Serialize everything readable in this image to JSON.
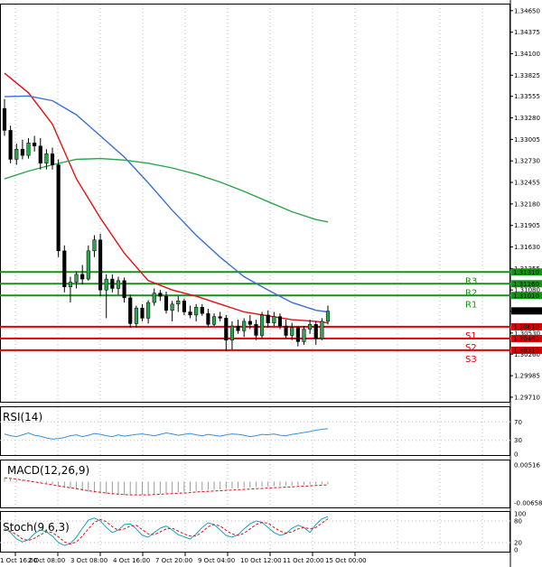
{
  "chart_data": {
    "type": "candlestick",
    "title": "",
    "x_labels": [
      "1 Oct 16:00",
      "2 Oct 08:00",
      "3 Oct 08:00",
      "4 Oct 16:00",
      "7 Oct 20:00",
      "9 Oct 04:00",
      "10 Oct 12:00",
      "11 Oct 20:00",
      "15 Oct 00:00"
    ],
    "y_ticks": [
      "1.34650",
      "1.34375",
      "1.34100",
      "1.33825",
      "1.33555",
      "1.33280",
      "1.33005",
      "1.32730",
      "1.32455",
      "1.32180",
      "1.31905",
      "1.31630",
      "1.31355",
      "1.31080",
      "1.30805",
      "1.30530",
      "1.30260",
      "1.29985",
      "1.29710"
    ],
    "ylim": [
      1.2964,
      1.3474
    ],
    "current_price": "1.30813",
    "levels": [
      {
        "name": "R3",
        "value": 1.3131,
        "label": "1.31310",
        "color": "#149414"
      },
      {
        "name": "R2",
        "value": 1.3116,
        "label": "1.31160",
        "color": "#149414"
      },
      {
        "name": "R1",
        "value": 1.3101,
        "label": "1.31010",
        "color": "#149414"
      },
      {
        "name": "S1",
        "value": 1.3061,
        "label": "1.30610",
        "color": "#e00000"
      },
      {
        "name": "S2",
        "value": 1.3046,
        "label": "1.30460",
        "color": "#e00000"
      },
      {
        "name": "S3",
        "value": 1.3031,
        "label": "1.30310",
        "color": "#e00000"
      }
    ],
    "candles": [
      [
        1.334,
        1.3352,
        1.3305,
        1.3312
      ],
      [
        1.3312,
        1.3318,
        1.327,
        1.3275
      ],
      [
        1.3275,
        1.3295,
        1.3268,
        1.3288
      ],
      [
        1.3288,
        1.33,
        1.3275,
        1.328
      ],
      [
        1.328,
        1.3302,
        1.3276,
        1.3296
      ],
      [
        1.3296,
        1.3305,
        1.3285,
        1.3292
      ],
      [
        1.3292,
        1.3302,
        1.3262,
        1.327
      ],
      [
        1.327,
        1.3288,
        1.3262,
        1.3282
      ],
      [
        1.3282,
        1.329,
        1.3262,
        1.3268
      ],
      [
        1.3268,
        1.3275,
        1.315,
        1.3158
      ],
      [
        1.3158,
        1.3165,
        1.3105,
        1.3112
      ],
      [
        1.3112,
        1.3125,
        1.3092,
        1.3118
      ],
      [
        1.3118,
        1.3132,
        1.311,
        1.3128
      ],
      [
        1.3128,
        1.314,
        1.3115,
        1.3122
      ],
      [
        1.3122,
        1.3165,
        1.312,
        1.3158
      ],
      [
        1.3158,
        1.3178,
        1.315,
        1.3172
      ],
      [
        1.3172,
        1.318,
        1.31,
        1.3108
      ],
      [
        1.3108,
        1.3128,
        1.3072,
        1.3122
      ],
      [
        1.3122,
        1.3128,
        1.3105,
        1.311
      ],
      [
        1.311,
        1.3125,
        1.3102,
        1.312
      ],
      [
        1.312,
        1.3124,
        1.3092,
        1.3098
      ],
      [
        1.3098,
        1.3102,
        1.306,
        1.3065
      ],
      [
        1.3065,
        1.3088,
        1.306,
        1.3085
      ],
      [
        1.3085,
        1.309,
        1.3068,
        1.3072
      ],
      [
        1.3072,
        1.3095,
        1.3065,
        1.3092
      ],
      [
        1.3092,
        1.311,
        1.3088,
        1.3104
      ],
      [
        1.3104,
        1.3108,
        1.3094,
        1.31
      ],
      [
        1.31,
        1.3106,
        1.3078,
        1.3082
      ],
      [
        1.3082,
        1.3094,
        1.3068,
        1.309
      ],
      [
        1.309,
        1.31,
        1.308,
        1.3094
      ],
      [
        1.3094,
        1.3097,
        1.3076,
        1.308
      ],
      [
        1.308,
        1.3088,
        1.3072,
        1.3076
      ],
      [
        1.3076,
        1.309,
        1.3068,
        1.3086
      ],
      [
        1.3086,
        1.309,
        1.3075,
        1.3078
      ],
      [
        1.3078,
        1.3084,
        1.306,
        1.3064
      ],
      [
        1.3064,
        1.3078,
        1.3062,
        1.3074
      ],
      [
        1.3074,
        1.308,
        1.3068,
        1.3072
      ],
      [
        1.3072,
        1.3076,
        1.303,
        1.3044
      ],
      [
        1.3044,
        1.3068,
        1.3032,
        1.3062
      ],
      [
        1.3062,
        1.307,
        1.3052,
        1.3056
      ],
      [
        1.3056,
        1.3072,
        1.3048,
        1.3068
      ],
      [
        1.3068,
        1.3076,
        1.3058,
        1.3064
      ],
      [
        1.3064,
        1.307,
        1.3044,
        1.305
      ],
      [
        1.305,
        1.308,
        1.3046,
        1.3076
      ],
      [
        1.3076,
        1.3082,
        1.306,
        1.3066
      ],
      [
        1.3066,
        1.308,
        1.3062,
        1.3074
      ],
      [
        1.3074,
        1.3078,
        1.3058,
        1.3062
      ],
      [
        1.3062,
        1.307,
        1.3046,
        1.305
      ],
      [
        1.305,
        1.3066,
        1.3044,
        1.306
      ],
      [
        1.306,
        1.3062,
        1.3036,
        1.3042
      ],
      [
        1.3042,
        1.3062,
        1.3038,
        1.3058
      ],
      [
        1.3058,
        1.307,
        1.3052,
        1.3064
      ],
      [
        1.3064,
        1.3068,
        1.3038,
        1.3046
      ],
      [
        1.3046,
        1.3072,
        1.3044,
        1.3068
      ],
      [
        1.3068,
        1.3088,
        1.3064,
        1.3081
      ]
    ],
    "moving_averages": [
      {
        "color": "#e01010",
        "values": [
          [
            0,
            1.3385
          ],
          [
            4,
            1.336
          ],
          [
            8,
            1.332
          ],
          [
            12,
            1.325
          ],
          [
            16,
            1.32
          ],
          [
            20,
            1.3155
          ],
          [
            24,
            1.312
          ],
          [
            28,
            1.3108
          ],
          [
            32,
            1.31
          ],
          [
            36,
            1.309
          ],
          [
            40,
            1.308
          ],
          [
            44,
            1.3075
          ],
          [
            48,
            1.307
          ],
          [
            52,
            1.3068
          ],
          [
            54,
            1.3066
          ]
        ]
      },
      {
        "color": "#3a6fd8",
        "values": [
          [
            0,
            1.3355
          ],
          [
            4,
            1.3356
          ],
          [
            8,
            1.335
          ],
          [
            12,
            1.3332
          ],
          [
            16,
            1.3305
          ],
          [
            20,
            1.3278
          ],
          [
            24,
            1.3245
          ],
          [
            28,
            1.321
          ],
          [
            32,
            1.3178
          ],
          [
            36,
            1.315
          ],
          [
            40,
            1.3125
          ],
          [
            44,
            1.3108
          ],
          [
            48,
            1.3092
          ],
          [
            52,
            1.3082
          ],
          [
            54,
            1.308
          ]
        ]
      },
      {
        "color": "#2aa64a",
        "values": [
          [
            0,
            1.325
          ],
          [
            4,
            1.326
          ],
          [
            8,
            1.3268
          ],
          [
            12,
            1.3275
          ],
          [
            16,
            1.3276
          ],
          [
            20,
            1.3274
          ],
          [
            24,
            1.327
          ],
          [
            28,
            1.3264
          ],
          [
            32,
            1.3256
          ],
          [
            36,
            1.3246
          ],
          [
            40,
            1.3234
          ],
          [
            44,
            1.3221
          ],
          [
            48,
            1.3208
          ],
          [
            52,
            1.3198
          ],
          [
            54,
            1.3195
          ]
        ]
      }
    ],
    "rsi": {
      "label": "RSI(14)",
      "ticks": [
        "70",
        "30",
        "0"
      ],
      "values": [
        44,
        40,
        38,
        42,
        46,
        41,
        39,
        35,
        33,
        34,
        36,
        40,
        42,
        38,
        41,
        45,
        43,
        40,
        38,
        42,
        39,
        41,
        43,
        44,
        42,
        40,
        43,
        46,
        44,
        41,
        43,
        45,
        42,
        40,
        43,
        41,
        39,
        42,
        44,
        43,
        41,
        38,
        40,
        43,
        42,
        44,
        41,
        40,
        43,
        45,
        47,
        49,
        52,
        54,
        55
      ]
    },
    "macd": {
      "label": "MACD(12,26,9)",
      "ticks": [
        "0.00516",
        "-0.006584"
      ],
      "hist": [
        0.001,
        0.0008,
        0.0006,
        0.0004,
        0.0002,
        0.0,
        -0.0002,
        -0.0005,
        -0.0008,
        -0.0012,
        -0.0016,
        -0.002,
        -0.0024,
        -0.0028,
        -0.0031,
        -0.0034,
        -0.0036,
        -0.0038,
        -0.004,
        -0.0041,
        -0.0042,
        -0.0042,
        -0.0042,
        -0.0041,
        -0.004,
        -0.0039,
        -0.0038,
        -0.0036,
        -0.0035,
        -0.0033,
        -0.0032,
        -0.003,
        -0.0029,
        -0.0027,
        -0.0026,
        -0.0025,
        -0.0024,
        -0.0022,
        -0.0021,
        -0.002,
        -0.0019,
        -0.0018,
        -0.0017,
        -0.0016,
        -0.0015,
        -0.0014,
        -0.0013,
        -0.0012,
        -0.0012,
        -0.0011,
        -0.001,
        -0.0009,
        -0.0009,
        -0.0008,
        -0.0008
      ],
      "signal": [
        0.0012,
        0.001,
        0.0008,
        0.0005,
        0.0002,
        -0.0001,
        -0.0004,
        -0.0007,
        -0.001,
        -0.0013,
        -0.0016,
        -0.0019,
        -0.0022,
        -0.0025,
        -0.0028,
        -0.0031,
        -0.0033,
        -0.0035,
        -0.0037,
        -0.0039,
        -0.004,
        -0.0041,
        -0.0041,
        -0.0041,
        -0.0041,
        -0.004,
        -0.0039,
        -0.0038,
        -0.0037,
        -0.0036,
        -0.0035,
        -0.0034,
        -0.0032,
        -0.0031,
        -0.003,
        -0.0029,
        -0.0028,
        -0.0027,
        -0.0026,
        -0.0025,
        -0.0024,
        -0.0023,
        -0.0022,
        -0.0021,
        -0.002,
        -0.0019,
        -0.0018,
        -0.0017,
        -0.0016,
        -0.0015,
        -0.0014,
        -0.0013,
        -0.0012,
        -0.0011,
        -0.001
      ]
    },
    "stoch": {
      "label": "Stoch(9,6,3)",
      "ticks": [
        "100",
        "80",
        "20",
        "0"
      ],
      "k": [
        60,
        48,
        30,
        22,
        28,
        45,
        55,
        50,
        38,
        20,
        12,
        18,
        35,
        60,
        82,
        88,
        80,
        62,
        48,
        55,
        70,
        72,
        58,
        40,
        35,
        48,
        60,
        66,
        55,
        42,
        36,
        30,
        44,
        62,
        75,
        70,
        55,
        40,
        35,
        42,
        58,
        72,
        80,
        76,
        62,
        48,
        40,
        45,
        60,
        68,
        62,
        48,
        70,
        86,
        92
      ],
      "d": [
        55,
        52,
        42,
        30,
        26,
        32,
        42,
        50,
        48,
        36,
        22,
        16,
        22,
        38,
        58,
        76,
        84,
        78,
        64,
        54,
        58,
        66,
        68,
        56,
        44,
        42,
        50,
        58,
        60,
        52,
        44,
        38,
        38,
        50,
        64,
        70,
        66,
        54,
        44,
        40,
        46,
        58,
        70,
        76,
        74,
        62,
        52,
        46,
        50,
        58,
        62,
        58,
        62,
        74,
        86
      ]
    }
  }
}
